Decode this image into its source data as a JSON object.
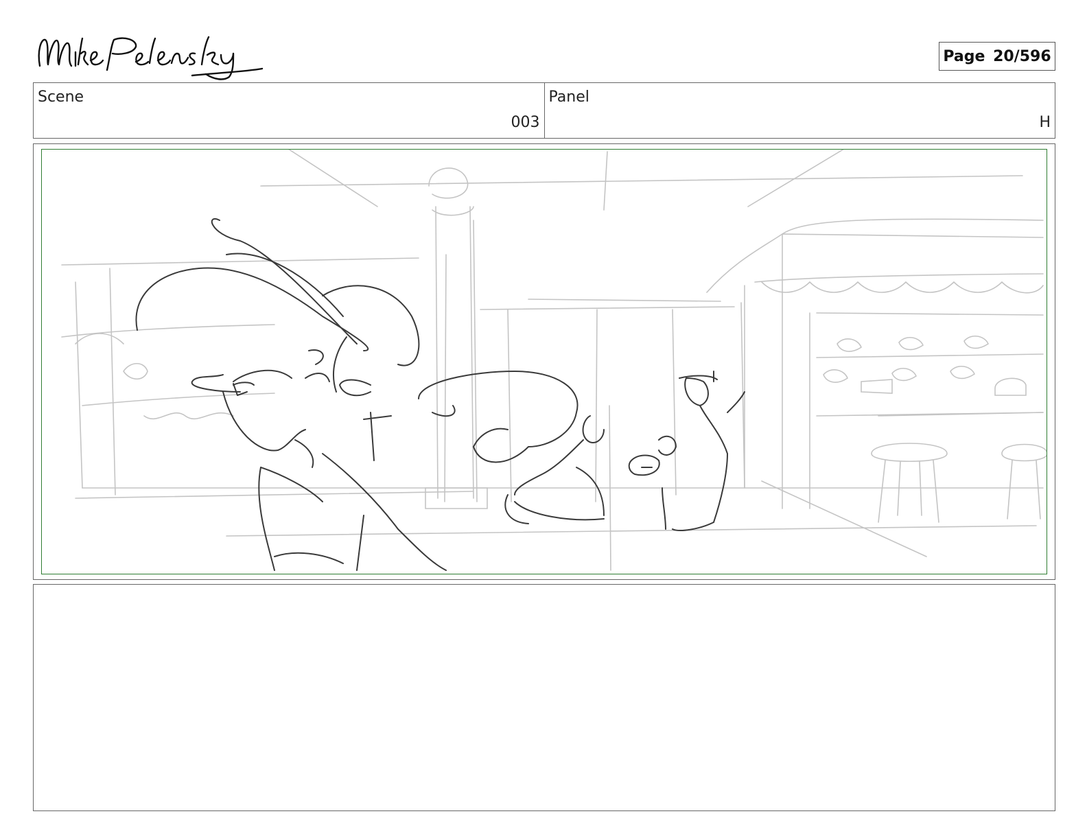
{
  "signature": "Mike Pelensky",
  "page": {
    "label": "Page",
    "current": "20",
    "total": "596",
    "display": "Page 20/596"
  },
  "scene": {
    "label": "Scene",
    "value": "003"
  },
  "panel": {
    "label": "Panel",
    "value": "H"
  },
  "sketch": {
    "description_icon": "storyboard-sketch-image",
    "colors": {
      "frame": "#2f7d32",
      "lines": "#333333",
      "background_lines": "#bbbbbb"
    }
  },
  "notes": {
    "text": ""
  }
}
